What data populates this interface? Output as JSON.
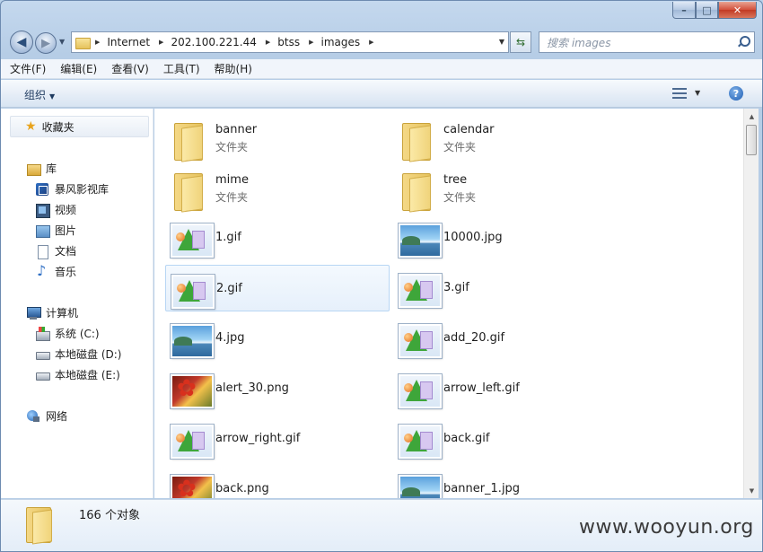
{
  "titlebar": {
    "blurred_text": "",
    "minimize": "–",
    "maximize": "□",
    "close": "✕"
  },
  "navigation": {
    "back": "◀",
    "forward": "▶",
    "breadcrumbs": [
      "Internet",
      "202.100.221.44",
      "btss",
      "images"
    ],
    "refresh": "⇆",
    "search_placeholder": "搜索 images"
  },
  "menu": [
    "文件(F)",
    "编辑(E)",
    "查看(V)",
    "工具(T)",
    "帮助(H)"
  ],
  "toolbar": {
    "organize": "组织",
    "help": "?"
  },
  "navpane": {
    "favorites": "收藏夹",
    "libraries": "库",
    "library_items": [
      "暴风影视库",
      "视频",
      "图片",
      "文档",
      "音乐"
    ],
    "computer": "计算机",
    "drives": [
      "系统 (C:)",
      "本地磁盘 (D:)",
      "本地磁盘 (E:)"
    ],
    "network": "网络"
  },
  "files": [
    {
      "name": "banner",
      "type": "文件夹",
      "kind": "folder"
    },
    {
      "name": "calendar",
      "type": "文件夹",
      "kind": "folder"
    },
    {
      "name": "mime",
      "type": "文件夹",
      "kind": "folder"
    },
    {
      "name": "tree",
      "type": "文件夹",
      "kind": "folder"
    },
    {
      "name": "1.gif",
      "kind": "gif"
    },
    {
      "name": "10000.jpg",
      "kind": "jpg"
    },
    {
      "name": "2.gif",
      "kind": "gif",
      "selected": true
    },
    {
      "name": "3.gif",
      "kind": "gif"
    },
    {
      "name": "4.jpg",
      "kind": "jpg"
    },
    {
      "name": "add_20.gif",
      "kind": "gif"
    },
    {
      "name": "alert_30.png",
      "kind": "png"
    },
    {
      "name": "arrow_left.gif",
      "kind": "gif"
    },
    {
      "name": "arrow_right.gif",
      "kind": "gif"
    },
    {
      "name": "back.gif",
      "kind": "gif"
    },
    {
      "name": "back.png",
      "kind": "png"
    },
    {
      "name": "banner_1.jpg",
      "kind": "jpg"
    }
  ],
  "status": {
    "count": "166 个对象"
  },
  "watermark": "www.wooyun.org"
}
